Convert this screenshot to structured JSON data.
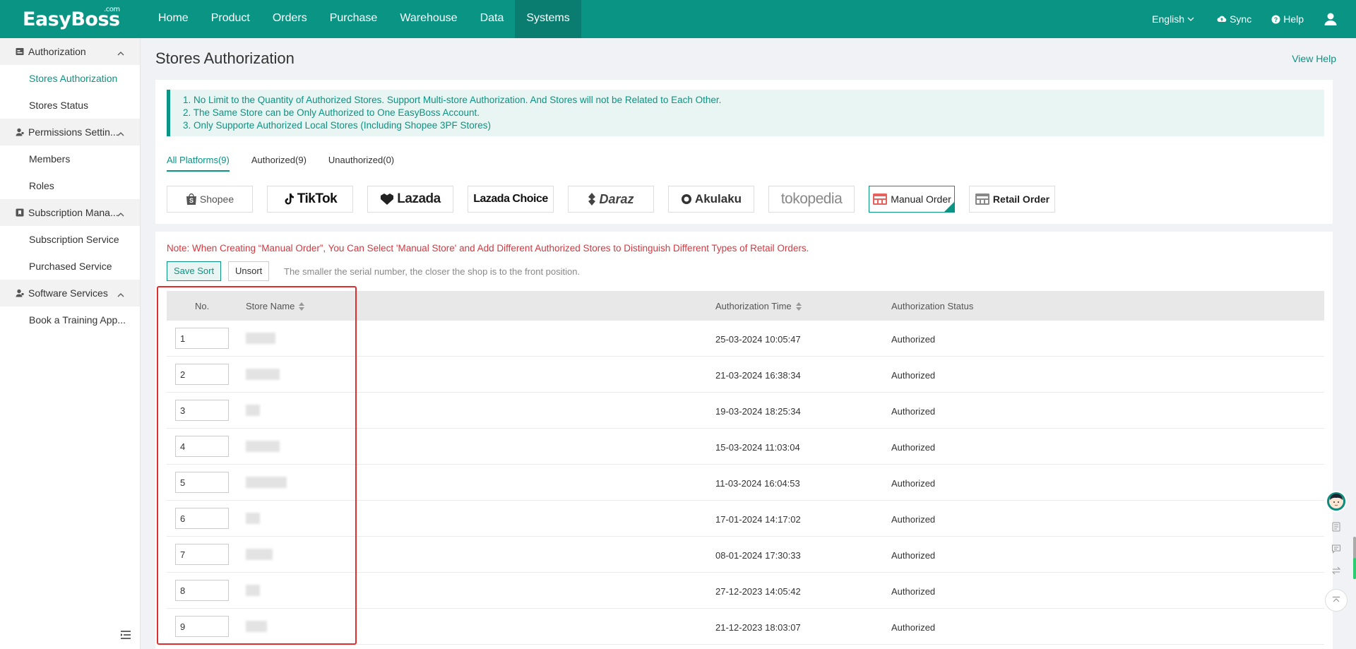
{
  "app": {
    "logo": "EasyBoss",
    "logo_suffix": ".com",
    "brand_color": "#099484"
  },
  "nav": {
    "items": [
      "Home",
      "Product",
      "Orders",
      "Purchase",
      "Warehouse",
      "Data",
      "Systems"
    ],
    "active": "Systems"
  },
  "top_right": {
    "language": "English",
    "sync": "Sync",
    "help": "Help"
  },
  "sidebar": {
    "groups": [
      {
        "label": "Authorization",
        "icon": "authorization-icon",
        "items": [
          "Stores Authorization",
          "Stores Status"
        ]
      },
      {
        "label": "Permissions Settin...",
        "icon": "user-key-icon",
        "items": [
          "Members",
          "Roles"
        ]
      },
      {
        "label": "Subscription Mana...",
        "icon": "bookmark-icon",
        "items": [
          "Subscription Service",
          "Purchased Service"
        ]
      },
      {
        "label": "Software Services",
        "icon": "user-key-icon",
        "items": [
          "Book a Training App..."
        ]
      }
    ],
    "active_item": "Stores Authorization"
  },
  "page": {
    "title": "Stores Authorization",
    "view_help": "View Help"
  },
  "notice": [
    "1. No Limit to the Quantity of Authorized Stores. Support Multi-store Authorization. And Stores will not be Related to Each Other.",
    "2. The Same Store can be Only Authorized to One EasyBoss Account.",
    "3. Only Supporte Authorized Local Stores (Including Shopee 3PF Stores)"
  ],
  "tabs": [
    {
      "label": "All Platforms(9)",
      "active": true
    },
    {
      "label": "Authorized(9)",
      "active": false
    },
    {
      "label": "Unauthorized(0)",
      "active": false
    }
  ],
  "platforms": [
    {
      "name": "Shopee",
      "icon": "shopee-bag-icon",
      "color": "#555555"
    },
    {
      "name": "TikTok",
      "icon": "tiktok-note-icon",
      "color": "#111111"
    },
    {
      "name": "Lazada",
      "icon": "lazada-heart-icon",
      "color": "#222222"
    },
    {
      "name": "Lazada Choice",
      "icon": "",
      "color": "#111111"
    },
    {
      "name": "Daraz",
      "icon": "daraz-icon",
      "color": "#444444"
    },
    {
      "name": "Akulaku",
      "icon": "akulaku-icon",
      "color": "#333333"
    },
    {
      "name": "tokopedia",
      "icon": "",
      "color": "#888888"
    },
    {
      "name": "Manual Order",
      "icon": "manual-order-icon",
      "color": "#222222",
      "selected": true
    },
    {
      "name": "Retail Order",
      "icon": "retail-order-icon",
      "color": "#222222"
    }
  ],
  "note": "Note: When Creating “Manual Order”, You Can Select 'Manual Store' and Add Different Authorized Stores to Distinguish Different Types of Retail Orders.",
  "buttons": {
    "save_sort": "Save Sort",
    "unsort": "Unsort"
  },
  "hint": "The smaller the serial number, the closer the shop is to the front position.",
  "table": {
    "headers": {
      "no": "No.",
      "store_name": "Store Name",
      "auth_time": "Authorization Time",
      "auth_status": "Authorization Status"
    },
    "rows": [
      {
        "no": "1",
        "store": "",
        "time": "25-03-2024 10:05:47",
        "status": "Authorized"
      },
      {
        "no": "2",
        "store": "",
        "time": "21-03-2024 16:38:34",
        "status": "Authorized"
      },
      {
        "no": "3",
        "store": "",
        "time": "19-03-2024 18:25:34",
        "status": "Authorized"
      },
      {
        "no": "4",
        "store": "",
        "time": "15-03-2024 11:03:04",
        "status": "Authorized"
      },
      {
        "no": "5",
        "store": "",
        "time": "11-03-2024 16:04:53",
        "status": "Authorized"
      },
      {
        "no": "6",
        "store": "",
        "time": "17-01-2024 14:17:02",
        "status": "Authorized"
      },
      {
        "no": "7",
        "store": "",
        "time": "08-01-2024 17:30:33",
        "status": "Authorized"
      },
      {
        "no": "8",
        "store": "",
        "time": "27-12-2023 14:05:42",
        "status": "Authorized"
      },
      {
        "no": "9",
        "store": "",
        "time": "21-12-2023 18:03:07",
        "status": "Authorized"
      }
    ]
  }
}
